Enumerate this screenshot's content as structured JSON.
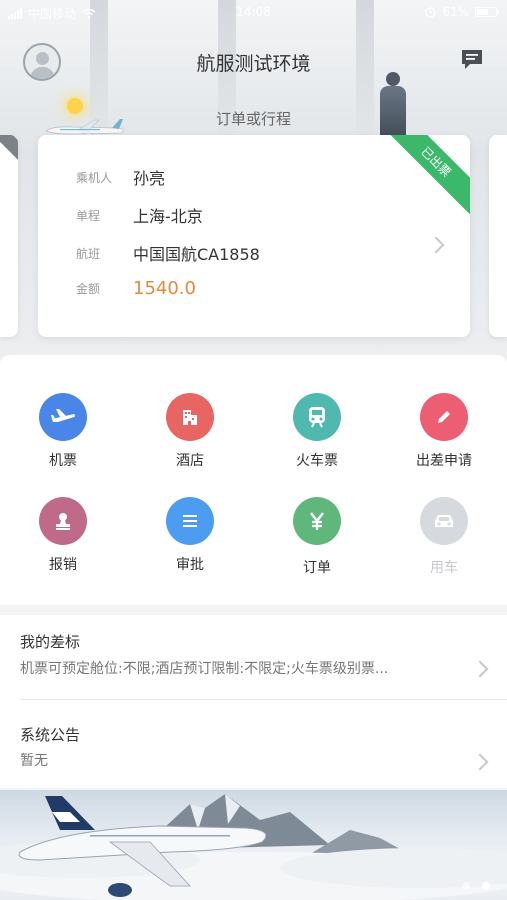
{
  "status_bar": {
    "carrier": "中国移动",
    "time": "14:08",
    "battery": "61%",
    "battery_level": 0.61
  },
  "header": {
    "title": "航服测试环境",
    "subtitle": "订单或行程"
  },
  "order_card": {
    "ribbon": "已出票",
    "rows": [
      {
        "label": "乘机人",
        "value": "孙亮"
      },
      {
        "label": "单程",
        "value": "上海-北京"
      },
      {
        "label": "航班",
        "value": "中国国航CA1858"
      },
      {
        "label": "金额",
        "value": "1540.0"
      }
    ]
  },
  "services": [
    {
      "label": "机票",
      "icon": "plane-icon",
      "color": "#4a86e8",
      "enabled": true
    },
    {
      "label": "酒店",
      "icon": "hotel-icon",
      "color": "#e76563",
      "enabled": true
    },
    {
      "label": "火车票",
      "icon": "train-icon",
      "color": "#4fb9b0",
      "enabled": true
    },
    {
      "label": "出差申请",
      "icon": "pencil-icon",
      "color": "#ec5f73",
      "enabled": true
    },
    {
      "label": "报销",
      "icon": "stamp-icon",
      "color": "#c06a8a",
      "enabled": true
    },
    {
      "label": "审批",
      "icon": "list-icon",
      "color": "#4c9df0",
      "enabled": true
    },
    {
      "label": "订单",
      "icon": "yen-icon",
      "color": "#5fb77c",
      "enabled": true
    },
    {
      "label": "用车",
      "icon": "car-icon",
      "color": "#d6d9dd",
      "enabled": false
    }
  ],
  "info": {
    "policy": {
      "title": "我的差标",
      "detail": "机票可预定舱位:不限;酒店预订限制:不限定;火车票级别票..."
    },
    "notice": {
      "title": "系统公告",
      "detail": "暂无"
    }
  },
  "banner": {
    "page_count": 2,
    "active_page": 2
  }
}
